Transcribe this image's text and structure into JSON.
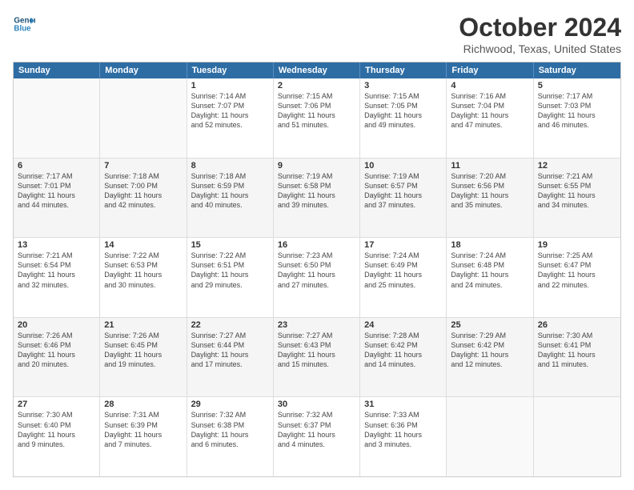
{
  "header": {
    "logo_line1": "General",
    "logo_line2": "Blue",
    "title": "October 2024",
    "subtitle": "Richwood, Texas, United States"
  },
  "weekdays": [
    "Sunday",
    "Monday",
    "Tuesday",
    "Wednesday",
    "Thursday",
    "Friday",
    "Saturday"
  ],
  "rows": [
    [
      {
        "day": "",
        "info": ""
      },
      {
        "day": "",
        "info": ""
      },
      {
        "day": "1",
        "info": "Sunrise: 7:14 AM\nSunset: 7:07 PM\nDaylight: 11 hours\nand 52 minutes."
      },
      {
        "day": "2",
        "info": "Sunrise: 7:15 AM\nSunset: 7:06 PM\nDaylight: 11 hours\nand 51 minutes."
      },
      {
        "day": "3",
        "info": "Sunrise: 7:15 AM\nSunset: 7:05 PM\nDaylight: 11 hours\nand 49 minutes."
      },
      {
        "day": "4",
        "info": "Sunrise: 7:16 AM\nSunset: 7:04 PM\nDaylight: 11 hours\nand 47 minutes."
      },
      {
        "day": "5",
        "info": "Sunrise: 7:17 AM\nSunset: 7:03 PM\nDaylight: 11 hours\nand 46 minutes."
      }
    ],
    [
      {
        "day": "6",
        "info": "Sunrise: 7:17 AM\nSunset: 7:01 PM\nDaylight: 11 hours\nand 44 minutes."
      },
      {
        "day": "7",
        "info": "Sunrise: 7:18 AM\nSunset: 7:00 PM\nDaylight: 11 hours\nand 42 minutes."
      },
      {
        "day": "8",
        "info": "Sunrise: 7:18 AM\nSunset: 6:59 PM\nDaylight: 11 hours\nand 40 minutes."
      },
      {
        "day": "9",
        "info": "Sunrise: 7:19 AM\nSunset: 6:58 PM\nDaylight: 11 hours\nand 39 minutes."
      },
      {
        "day": "10",
        "info": "Sunrise: 7:19 AM\nSunset: 6:57 PM\nDaylight: 11 hours\nand 37 minutes."
      },
      {
        "day": "11",
        "info": "Sunrise: 7:20 AM\nSunset: 6:56 PM\nDaylight: 11 hours\nand 35 minutes."
      },
      {
        "day": "12",
        "info": "Sunrise: 7:21 AM\nSunset: 6:55 PM\nDaylight: 11 hours\nand 34 minutes."
      }
    ],
    [
      {
        "day": "13",
        "info": "Sunrise: 7:21 AM\nSunset: 6:54 PM\nDaylight: 11 hours\nand 32 minutes."
      },
      {
        "day": "14",
        "info": "Sunrise: 7:22 AM\nSunset: 6:53 PM\nDaylight: 11 hours\nand 30 minutes."
      },
      {
        "day": "15",
        "info": "Sunrise: 7:22 AM\nSunset: 6:51 PM\nDaylight: 11 hours\nand 29 minutes."
      },
      {
        "day": "16",
        "info": "Sunrise: 7:23 AM\nSunset: 6:50 PM\nDaylight: 11 hours\nand 27 minutes."
      },
      {
        "day": "17",
        "info": "Sunrise: 7:24 AM\nSunset: 6:49 PM\nDaylight: 11 hours\nand 25 minutes."
      },
      {
        "day": "18",
        "info": "Sunrise: 7:24 AM\nSunset: 6:48 PM\nDaylight: 11 hours\nand 24 minutes."
      },
      {
        "day": "19",
        "info": "Sunrise: 7:25 AM\nSunset: 6:47 PM\nDaylight: 11 hours\nand 22 minutes."
      }
    ],
    [
      {
        "day": "20",
        "info": "Sunrise: 7:26 AM\nSunset: 6:46 PM\nDaylight: 11 hours\nand 20 minutes."
      },
      {
        "day": "21",
        "info": "Sunrise: 7:26 AM\nSunset: 6:45 PM\nDaylight: 11 hours\nand 19 minutes."
      },
      {
        "day": "22",
        "info": "Sunrise: 7:27 AM\nSunset: 6:44 PM\nDaylight: 11 hours\nand 17 minutes."
      },
      {
        "day": "23",
        "info": "Sunrise: 7:27 AM\nSunset: 6:43 PM\nDaylight: 11 hours\nand 15 minutes."
      },
      {
        "day": "24",
        "info": "Sunrise: 7:28 AM\nSunset: 6:42 PM\nDaylight: 11 hours\nand 14 minutes."
      },
      {
        "day": "25",
        "info": "Sunrise: 7:29 AM\nSunset: 6:42 PM\nDaylight: 11 hours\nand 12 minutes."
      },
      {
        "day": "26",
        "info": "Sunrise: 7:30 AM\nSunset: 6:41 PM\nDaylight: 11 hours\nand 11 minutes."
      }
    ],
    [
      {
        "day": "27",
        "info": "Sunrise: 7:30 AM\nSunset: 6:40 PM\nDaylight: 11 hours\nand 9 minutes."
      },
      {
        "day": "28",
        "info": "Sunrise: 7:31 AM\nSunset: 6:39 PM\nDaylight: 11 hours\nand 7 minutes."
      },
      {
        "day": "29",
        "info": "Sunrise: 7:32 AM\nSunset: 6:38 PM\nDaylight: 11 hours\nand 6 minutes."
      },
      {
        "day": "30",
        "info": "Sunrise: 7:32 AM\nSunset: 6:37 PM\nDaylight: 11 hours\nand 4 minutes."
      },
      {
        "day": "31",
        "info": "Sunrise: 7:33 AM\nSunset: 6:36 PM\nDaylight: 11 hours\nand 3 minutes."
      },
      {
        "day": "",
        "info": ""
      },
      {
        "day": "",
        "info": ""
      }
    ]
  ]
}
